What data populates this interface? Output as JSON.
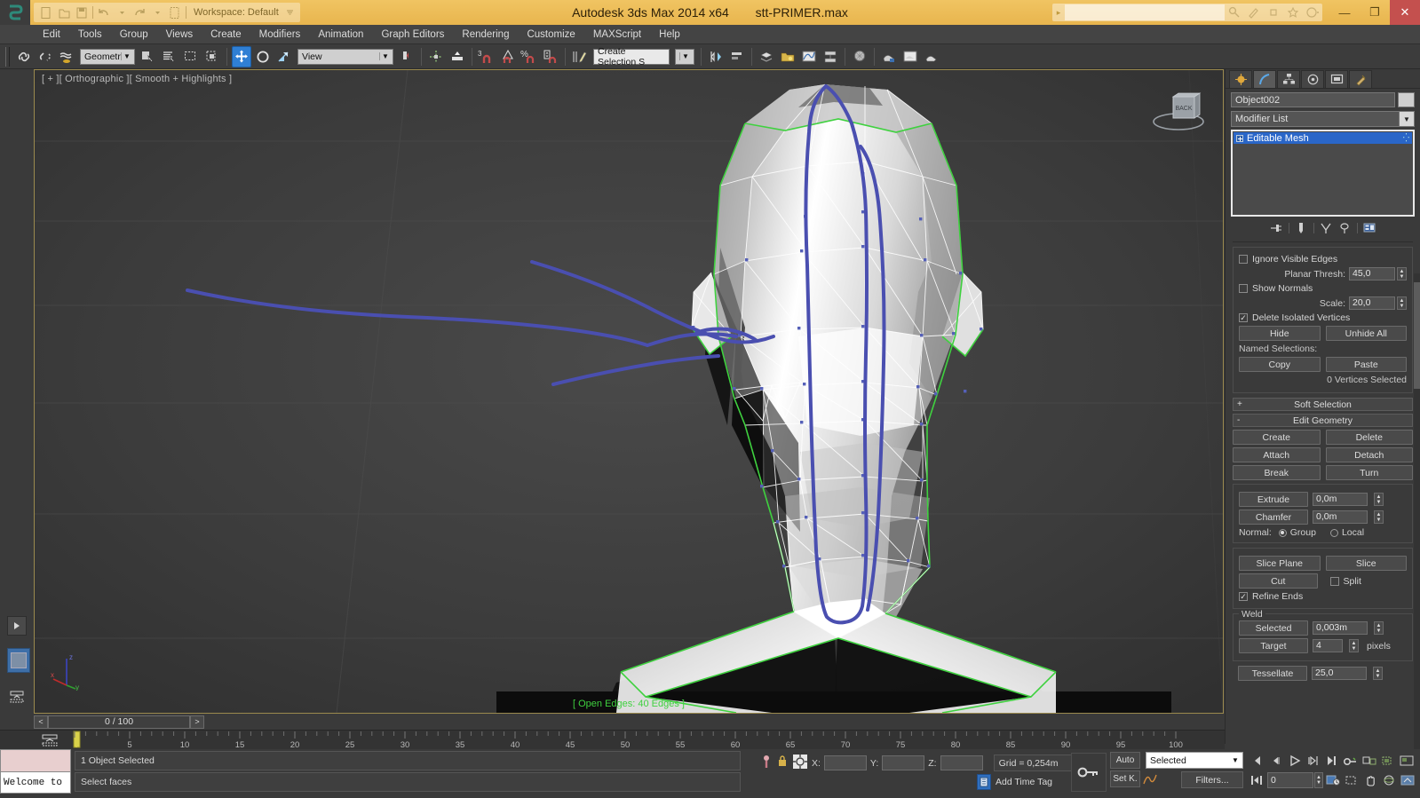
{
  "titlebar": {
    "app_title": "Autodesk 3ds Max  2014 x64",
    "file_name": "stt-PRIMER.max",
    "workspace_label": "Workspace: Default",
    "minimize_glyph": "—",
    "maximize_glyph": "❐",
    "close_glyph": "✕",
    "accent_color": "#e8b54e"
  },
  "menu": {
    "items": [
      "Edit",
      "Tools",
      "Group",
      "Views",
      "Create",
      "Modifiers",
      "Animation",
      "Graph Editors",
      "Rendering",
      "Customize",
      "MAXScript",
      "Help"
    ]
  },
  "toolbar": {
    "selection_filter": "Geometr",
    "reference_coord": "View",
    "named_selection_set": "Create Selection S",
    "snap_percent_label": "%",
    "snap_angle_label": "3"
  },
  "viewport": {
    "label": "[ + ][ Orthographic ][ Smooth + Highlights ]",
    "status_text": "[ Open Edges: 40 Edges ]",
    "viewcube_label": "BACK",
    "axis": {
      "x": "x",
      "y": "y",
      "z": "z"
    },
    "background_color": "#3b3b3b",
    "open_edge_color": "#3fd13f",
    "annotation_color": "#4a4fb0"
  },
  "command_panel": {
    "tabs": [
      "create-tab",
      "modify-tab",
      "hierarchy-tab",
      "motion-tab",
      "display-tab",
      "utilities-tab"
    ],
    "active_tab_index": 1,
    "object_name": "Object002",
    "modifier_list_label": "Modifier List",
    "modifier_stack": [
      "Editable Mesh"
    ],
    "selection_rollout": {
      "ignore_visible_edges_label": "Ignore Visible Edges",
      "ignore_visible_edges_checked": false,
      "planar_thresh_label": "Planar Thresh:",
      "planar_thresh_value": "45,0",
      "show_normals_label": "Show Normals",
      "show_normals_checked": false,
      "scale_label": "Scale:",
      "scale_value": "20,0",
      "delete_isolated_label": "Delete Isolated Vertices",
      "delete_isolated_checked": true,
      "hide_label": "Hide",
      "unhide_all_label": "Unhide All",
      "named_selections_label": "Named Selections:",
      "copy_label": "Copy",
      "paste_label": "Paste",
      "vertices_selected_text": "0 Vertices Selected"
    },
    "soft_selection_header": "Soft Selection",
    "soft_selection_state": "+",
    "edit_geometry_header": "Edit Geometry",
    "edit_geometry_state": "-",
    "edit_geometry": {
      "create_label": "Create",
      "delete_label": "Delete",
      "attach_label": "Attach",
      "detach_label": "Detach",
      "break_label": "Break",
      "turn_label": "Turn",
      "extrude_label": "Extrude",
      "extrude_value": "0,0m",
      "chamfer_label": "Chamfer",
      "chamfer_value": "0,0m",
      "normal_label": "Normal:",
      "normal_group_label": "Group",
      "normal_local_label": "Local",
      "normal_selected": "Group",
      "slice_plane_label": "Slice Plane",
      "slice_label": "Slice",
      "cut_label": "Cut",
      "split_label": "Split",
      "split_checked": false,
      "refine_ends_label": "Refine Ends",
      "refine_ends_checked": true,
      "weld_legend": "Weld",
      "weld_selected_label": "Selected",
      "weld_selected_value": "0,003m",
      "weld_target_label": "Target",
      "weld_target_value": "4",
      "weld_pixels_label": "pixels",
      "tessellate_label": "Tessellate",
      "tessellate_value": "25,0"
    }
  },
  "time_slider": {
    "prev_glyph": "<",
    "next_glyph": ">",
    "frame_readout": "0 / 100",
    "ticks": [
      "5",
      "10",
      "15",
      "20",
      "25",
      "30",
      "35",
      "40",
      "45",
      "50",
      "55",
      "60",
      "65",
      "70",
      "75",
      "80",
      "85",
      "90",
      "95",
      "100"
    ],
    "current_frame_label": "0"
  },
  "statusbar": {
    "listener_text": "Welcome to",
    "line1": "1 Object Selected",
    "line2": "Select faces",
    "coord_x_label": "X:",
    "coord_y_label": "Y:",
    "coord_z_label": "Z:",
    "coord_x_value": "",
    "coord_y_value": "",
    "coord_z_value": "",
    "grid_text": "Grid = 0,254m",
    "add_time_tag_label": "Add Time Tag",
    "auto_key_label": "Auto",
    "set_key_label": "Set K.",
    "key_filter_selection": "Selected",
    "filters_label": "Filters...",
    "frame_field_value": "0"
  }
}
